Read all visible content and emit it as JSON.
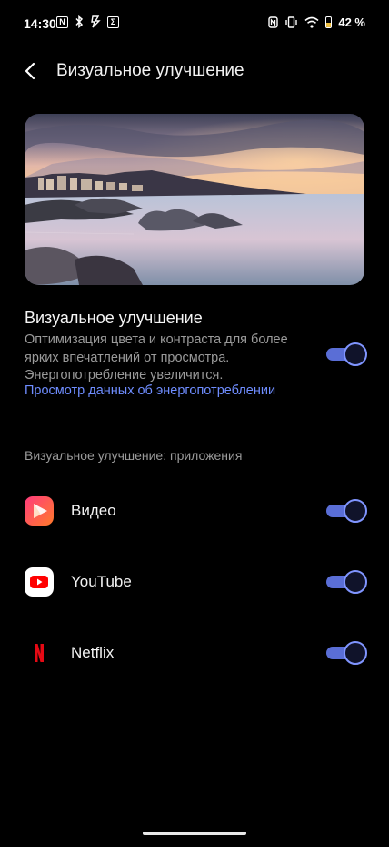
{
  "status_bar": {
    "time": "14:30",
    "left_icons": [
      "n-square-icon",
      "bluetooth-icon",
      "app-notification-icon",
      "sigma-square-icon"
    ],
    "right_icons": [
      "nfc-icon",
      "vibrate-icon",
      "wifi-icon",
      "battery-icon"
    ],
    "battery_percent": "42 %",
    "battery_level": 0.42
  },
  "header": {
    "title": "Визуальное улучшение"
  },
  "main_setting": {
    "title": "Визуальное улучшение",
    "description": "Оптимизация цвета и контраста для более ярких впечатлений от просмотра. Энергопотребление увеличится.",
    "link": "Просмотр данных об энергопотреблении",
    "enabled": true
  },
  "apps_section": {
    "title": "Визуальное улучшение: приложения",
    "items": [
      {
        "label": "Видео",
        "icon": "video-app-icon",
        "enabled": true
      },
      {
        "label": "YouTube",
        "icon": "youtube-icon",
        "enabled": true
      },
      {
        "label": "Netflix",
        "icon": "netflix-icon",
        "enabled": true
      }
    ]
  },
  "colors": {
    "accent": "#6f8dff",
    "toggle_track": "#5a6ed6",
    "background": "#000000"
  }
}
